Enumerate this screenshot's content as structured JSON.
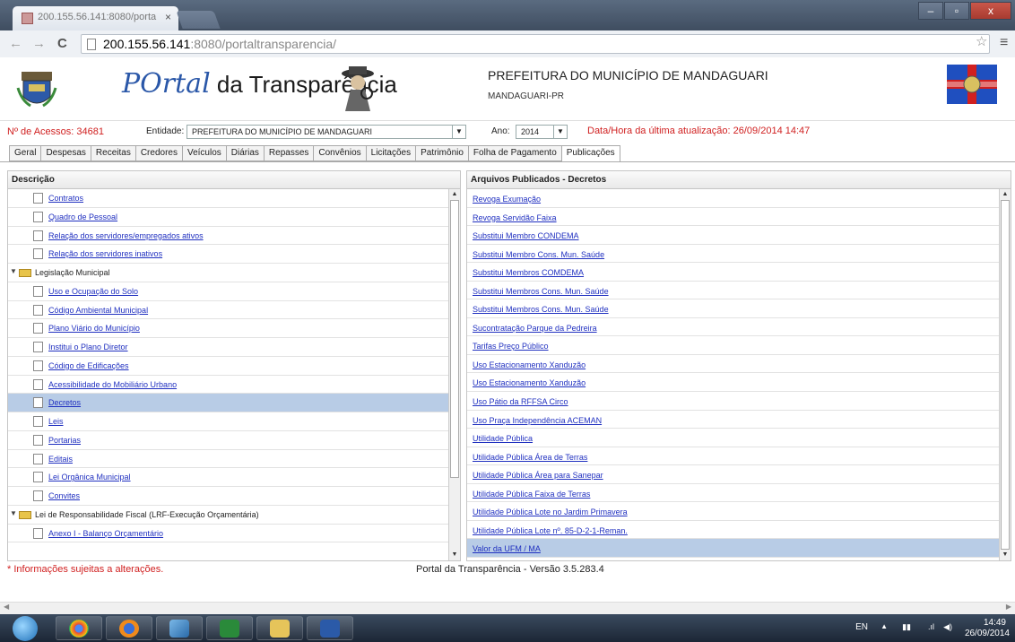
{
  "browser": {
    "tab_title": "200.155.56.141:8080/porta",
    "tab_close": "×",
    "window_controls": [
      "–",
      "▫",
      "x"
    ],
    "nav": {
      "back": "←",
      "forward": "→",
      "reload": "C"
    },
    "url_host": "200.155.56.141",
    "url_path": ":8080/portaltransparencia/",
    "star_icon": "☆",
    "menu_icon": "≡"
  },
  "header": {
    "logo_po": "POrtal",
    "logo_rest": "da Transparência",
    "prefeitura_title": "PREFEITURA DO MUNICÍPIO DE MANDAGUARI",
    "prefeitura_subtitle": "MANDAGUARI-PR"
  },
  "infobar": {
    "acessos": "Nº de Acessos: 34681",
    "entidade_label": "Entidade:",
    "entidade_value": "PREFEITURA DO MUNICÍPIO DE MANDAGUARI",
    "ano_label": "Ano:",
    "ano_value": "2014",
    "atualizacao": "Data/Hora da última atualização: 26/09/2014 14:47"
  },
  "tabs": [
    {
      "label": "Geral",
      "active": false
    },
    {
      "label": "Despesas",
      "active": false
    },
    {
      "label": "Receitas",
      "active": false
    },
    {
      "label": "Credores",
      "active": false
    },
    {
      "label": "Veículos",
      "active": false
    },
    {
      "label": "Diárias",
      "active": false
    },
    {
      "label": "Repasses",
      "active": false
    },
    {
      "label": "Convênios",
      "active": false
    },
    {
      "label": "Licitações",
      "active": false
    },
    {
      "label": "Patrimônio",
      "active": false
    },
    {
      "label": "Folha de Pagamento",
      "active": false
    },
    {
      "label": "Publicações",
      "active": true
    }
  ],
  "left_panel": {
    "header": "Descrição",
    "rows": [
      {
        "type": "doc",
        "label": "Contratos",
        "indent": 2
      },
      {
        "type": "doc",
        "label": "Quadro de Pessoal",
        "indent": 2
      },
      {
        "type": "doc",
        "label": "Relação dos servidores/empregados ativos",
        "indent": 2
      },
      {
        "type": "doc",
        "label": "Relação dos servidores inativos",
        "indent": 2
      },
      {
        "type": "folder",
        "label": "Legislação Municipal",
        "indent": 1
      },
      {
        "type": "doc",
        "label": "Uso e Ocupação do Solo",
        "indent": 2
      },
      {
        "type": "doc",
        "label": "Código Ambiental Municipal",
        "indent": 2
      },
      {
        "type": "doc",
        "label": "Plano Viário do Município",
        "indent": 2
      },
      {
        "type": "doc",
        "label": "Institui o Plano Diretor",
        "indent": 2
      },
      {
        "type": "doc",
        "label": "Código de Edificações",
        "indent": 2
      },
      {
        "type": "doc",
        "label": "Acessibilidade do Mobiliário Urbano",
        "indent": 2
      },
      {
        "type": "doc",
        "label": "Decretos",
        "indent": 2,
        "selected": true
      },
      {
        "type": "doc",
        "label": "Leis",
        "indent": 2
      },
      {
        "type": "doc",
        "label": "Portarias",
        "indent": 2
      },
      {
        "type": "doc",
        "label": "Editais",
        "indent": 2
      },
      {
        "type": "doc",
        "label": "Lei Orgânica Municipal",
        "indent": 2
      },
      {
        "type": "doc",
        "label": "Convites",
        "indent": 2
      },
      {
        "type": "folder",
        "label": "Lei de Responsabilidade Fiscal (LRF-Execução Orçamentária)",
        "indent": 1
      },
      {
        "type": "doc",
        "label": "Anexo I - Balanço Orçamentário",
        "indent": 2
      }
    ]
  },
  "right_panel": {
    "header": "Arquivos Publicados - Decretos",
    "rows": [
      "Revoga Exumação",
      "Revoga Servidão Faixa",
      "Substitui Membro CONDEMA",
      "Substitui Membro Cons. Mun. Saúde",
      "Substitui Membros COMDEMA",
      "Substitui Membros Cons. Mun. Saúde",
      "Substitui Membros Cons. Mun. Saúde",
      "Sucontratação Parque da Pedreira",
      "Tarifas Preço Público",
      "Uso Estacionamento Xanduzão",
      "Uso Estacionamento Xanduzão",
      "Uso Pátio da RFFSA Circo",
      "Uso Praça Independência ACEMAN",
      "Utilidade Pública",
      "Utilidade Pública Área de Terras",
      "Utilidade Pública Área para Sanepar",
      "Utilidade Pública Faixa de Terras",
      "Utilidade Pública Lote no Jardim Primavera",
      "Utilidade Pública Lote nº. 85-D-2-1-Reman.",
      "Valor da UFM / MA"
    ],
    "selected_index": 19
  },
  "footer": {
    "note": "* Informações sujeitas a alterações.",
    "version": "Portal da Transparência - Versão 3.5.283.4"
  },
  "taskbar": {
    "lang": "EN",
    "time": "14:49",
    "date": "26/09/2014",
    "apps": [
      "windows-start-orb",
      "chrome-icon",
      "firefox-icon",
      "app-cube-icon",
      "excel-icon",
      "file-explorer-icon",
      "word-icon"
    ]
  },
  "colors": {
    "accent_red": "#d02020",
    "link_blue": "#2030c0",
    "selected_row": "#b8cce6"
  }
}
